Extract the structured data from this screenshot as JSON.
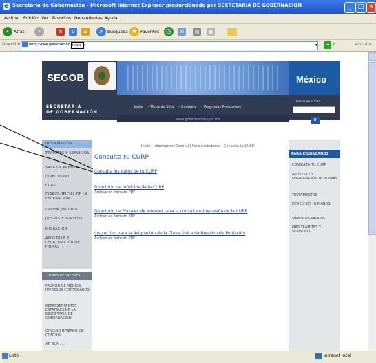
{
  "window": {
    "title": "Secretaría de Gobernación - Microsoft Internet Explorer proporcionado por SECRETARIA DE GOBERNACION"
  },
  "menu": [
    "Archivo",
    "Edición",
    "Ver",
    "Favoritos",
    "Herramientas",
    "Ayuda"
  ],
  "toolbar": {
    "back": "Atrás",
    "search": "Búsqueda",
    "favorites": "Favoritos"
  },
  "address": {
    "label": "Dirección",
    "value": "http://www.gobernacion.gob.mx/",
    "tooltip": "Inicio",
    "go": "Ir",
    "links": "Vínculos"
  },
  "header": {
    "logo": "SEGOB",
    "line1": "SECRETARÍA",
    "line2": "DE GOBERNACIÓN",
    "nav": [
      "Inicio",
      "Mapa de Sitio",
      "Contacto",
      "Preguntas Frecuentes"
    ],
    "url": "www.gobernacion.gob.mx",
    "mexico": "México",
    "search_label": "Buscar en el Sitio",
    "search_button": "Ir"
  },
  "left_nav": [
    "INFORMACIÓN",
    "TRÁMITES Y SERVICIOS",
    "SALA DE PRENSA",
    "DIRECTORIO",
    "CURP",
    "DIARIO OFICIAL DE LA FEDERACIÓN",
    "ORDEN JURÍDICO",
    "JUEGOS Y SORTEOS",
    "MIGRACIÓN",
    "APOSTILLE Y LEGALIZACIÓN DE FIRMAS"
  ],
  "temas": {
    "title": "TEMAS DE INTERÉS",
    "items": [
      "PADRÓN DE MEDIOS IMPRESOS CERTIFICADOS",
      "REPRESENTANTES ESTATALES DE LA SECRETARÍA DE GOBERNACIÓN",
      "ÓRGANO INTERNO DE CONTROL",
      "AT. NÚM. ..."
    ]
  },
  "content": {
    "breadcrumb": "Inicio | Información General | Para ciudadanos | Consulta tu CURP",
    "title": "Consulta tu CURP",
    "links": [
      {
        "label": "Consulta los datos de tu CURP",
        "sub": ""
      },
      {
        "label": "Directorio de módulos de la CURP",
        "sub": "Archivo en formato PDF"
      },
      {
        "label": "Directorio de Portales de Internet para la consulta e impresión de la CURP",
        "sub": "Archivo en formato PDF"
      },
      {
        "label": "Instructivo para la Asignación de la Clave Única de Registro de Población",
        "sub": "Archivo en formato PDF"
      }
    ]
  },
  "right_nav": {
    "title": "PARA CIUDADANOS",
    "items": [
      "CONSULTA TU CURP",
      "APOSTILLE Y LEGALIZACIÓN DE FIRMAS",
      "TESTAMENTOS",
      "DERECHOS HUMANOS",
      "SÍMBOLOS PATRIOS",
      "MÁS TRÁMITES Y SERVICIOS"
    ]
  },
  "status": {
    "left": "Listo",
    "zone": "Intranet local"
  },
  "colors": {
    "titlebar": "#1f55c7",
    "header": "#2f3c52",
    "accent": "#1d5aa6",
    "link": "#1f3fbf"
  }
}
